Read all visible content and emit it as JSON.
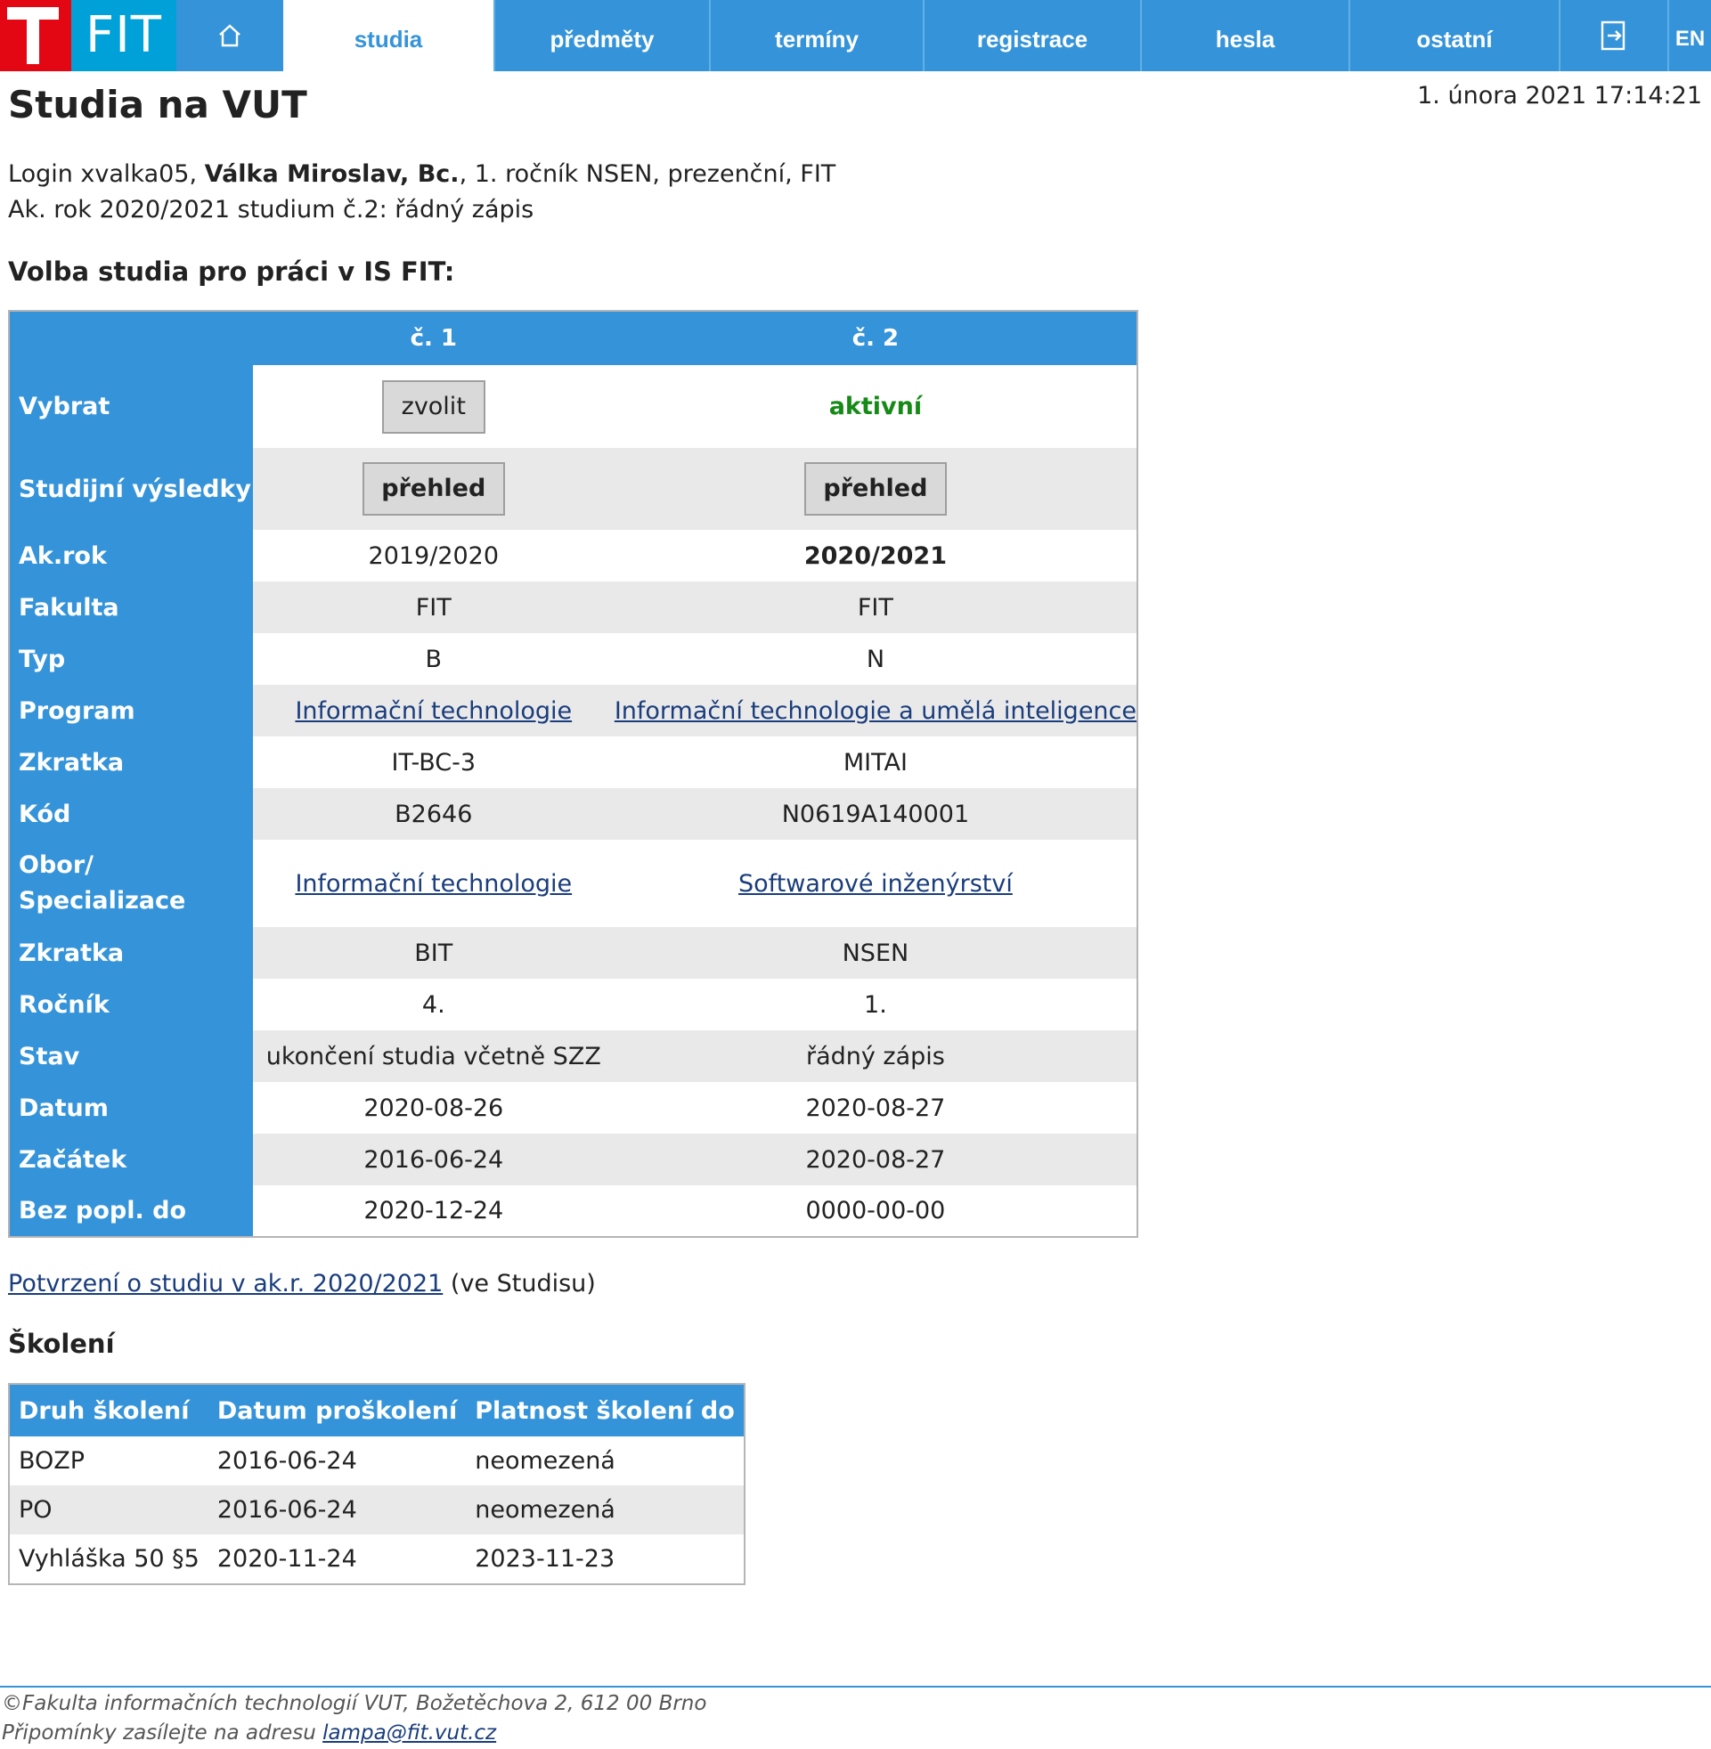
{
  "nav": {
    "logo_fit": "FIT",
    "items": [
      {
        "label": "studia"
      },
      {
        "label": "předměty"
      },
      {
        "label": "termíny"
      },
      {
        "label": "registrace"
      },
      {
        "label": "hesla"
      },
      {
        "label": "ostatní"
      }
    ],
    "lang": "EN",
    "icons": [
      "home-icon",
      "logout-icon"
    ],
    "colors": {
      "bar": "#3594d9",
      "logo_red": "#e30613",
      "logo_cyan": "#00a0d9"
    }
  },
  "header": {
    "title": "Studia na VUT",
    "datetime": "1. února 2021 17:14:21",
    "info_login_prefix": "Login xvalka05, ",
    "info_name": "Válka Miroslav, Bc.",
    "info_login_suffix": ", 1. ročník NSEN, prezenční, FIT",
    "info_year": "Ak. rok 2020/2021 studium č.2: řádný zápis"
  },
  "study_section": {
    "title": "Volba studia pro práci v IS FIT:",
    "columns": [
      "č. 1",
      "č. 2"
    ],
    "rows": {
      "vybrat": {
        "label": "Vybrat",
        "col1_button": "zvolit",
        "col2_status": "aktivní"
      },
      "vysledky": {
        "label": "Studijní výsledky",
        "col1_button": "přehled",
        "col2_button": "přehled"
      },
      "akrok": {
        "label": "Ak.rok",
        "col1": "2019/2020",
        "col2": "2020/2021"
      },
      "fakulta": {
        "label": "Fakulta",
        "col1": "FIT",
        "col2": "FIT"
      },
      "typ": {
        "label": "Typ",
        "col1": "B",
        "col2": "N"
      },
      "program": {
        "label": "Program",
        "col1": "Informační technologie",
        "col2": "Informační technologie a umělá inteligence"
      },
      "zkratka1": {
        "label": "Zkratka",
        "col1": "IT-BC-3",
        "col2": "MITAI"
      },
      "kod": {
        "label": "Kód",
        "col1": "B2646",
        "col2": "N0619A140001"
      },
      "obor": {
        "label_line1": "Obor/",
        "label_line2": "Specializace",
        "col1": "Informační technologie",
        "col2": "Softwarové inženýrství"
      },
      "zkratka2": {
        "label": "Zkratka",
        "col1": "BIT",
        "col2": "NSEN"
      },
      "rocnik": {
        "label": "Ročník",
        "col1": "4.",
        "col2": "1."
      },
      "stav": {
        "label": "Stav",
        "col1": "ukončení studia včetně SZZ",
        "col2": "řádný zápis"
      },
      "datum": {
        "label": "Datum",
        "col1": "2020-08-26",
        "col2": "2020-08-27"
      },
      "zacatek": {
        "label": "Začátek",
        "col1": "2016-06-24",
        "col2": "2020-08-27"
      },
      "bezpopl": {
        "label": "Bez popl. do",
        "col1": "2020-12-24",
        "col2": "0000-00-00"
      }
    }
  },
  "confirmation": {
    "link": "Potvrzení o studiu v ak.r. 2020/2021",
    "suffix": " (ve Studisu)"
  },
  "training": {
    "title": "Školení",
    "headers": [
      "Druh školení",
      "Datum proškolení",
      "Platnost školení do"
    ],
    "rows": [
      {
        "druh": "BOZP",
        "datum": "2016-06-24",
        "platnost": "neomezená"
      },
      {
        "druh": "PO",
        "datum": "2016-06-24",
        "platnost": "neomezená"
      },
      {
        "druh": "Vyhláška 50 §5",
        "datum": "2020-11-24",
        "platnost": "2023-11-23"
      }
    ]
  },
  "footer": {
    "line1": "©Fakulta informačních technologií VUT, Božetěchova 2, 612 00 Brno",
    "line2_prefix": "Připomínky zasílejte na adresu ",
    "email": "lampa@fit.vut.cz"
  }
}
